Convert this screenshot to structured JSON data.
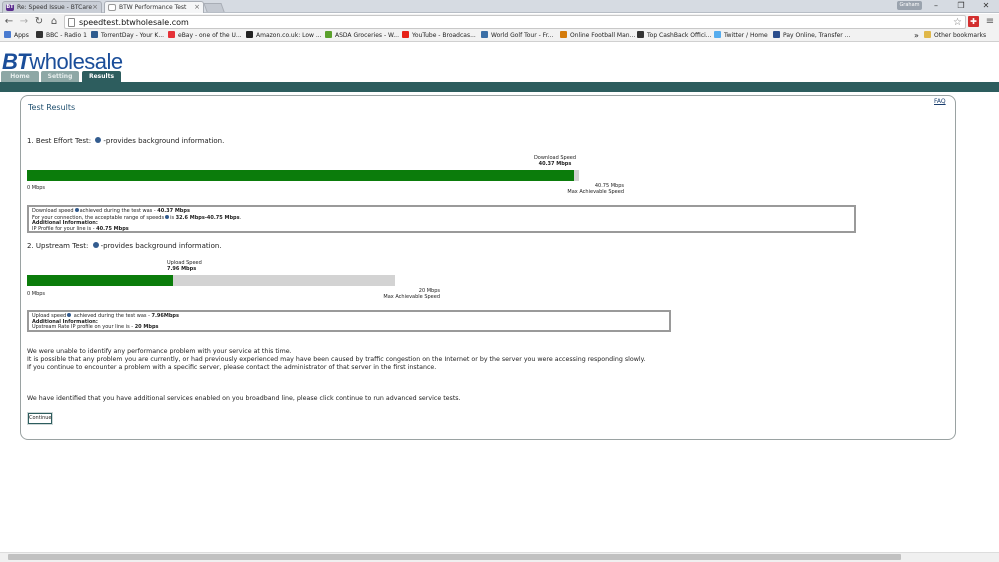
{
  "browser": {
    "tabs": [
      {
        "label": "Re: Speed Issue - BTCare",
        "icon": "BT",
        "active": false
      },
      {
        "label": "BTW Performance Test",
        "icon": "page",
        "active": true
      }
    ],
    "user_badge": "Graham",
    "url": "speedtest.btwholesale.com",
    "bookmarks": [
      {
        "label": "Apps",
        "icon": "grid-icon",
        "color": "#4a7bd0"
      },
      {
        "label": "BBC - Radio 1",
        "icon": "bbc-icon",
        "color": "#333333"
      },
      {
        "label": "TorrentDay - Your K...",
        "icon": "td-icon",
        "color": "#2e5b8e"
      },
      {
        "label": "eBay - one of the U...",
        "icon": "ebay-icon",
        "color": "#e53238"
      },
      {
        "label": "Amazon.co.uk: Low ...",
        "icon": "amazon-icon",
        "color": "#222222"
      },
      {
        "label": "ASDA Groceries - W...",
        "icon": "asda-icon",
        "color": "#5aa02c"
      },
      {
        "label": "YouTube - Broadcas...",
        "icon": "youtube-icon",
        "color": "#e62117"
      },
      {
        "label": "World Golf Tour - Fr...",
        "icon": "globe-icon",
        "color": "#3a6ea5"
      },
      {
        "label": "Online Football Man...",
        "icon": "football-icon",
        "color": "#d47b0b"
      },
      {
        "label": "Top CashBack Offici...",
        "icon": "cashback-icon",
        "color": "#333333"
      },
      {
        "label": "Twitter / Home",
        "icon": "twitter-icon",
        "color": "#55acee"
      },
      {
        "label": "Pay Online, Transfer ...",
        "icon": "paypal-icon",
        "color": "#2b4d8c"
      }
    ],
    "other_bookmarks": "Other bookmarks"
  },
  "site": {
    "logo_bt": "BT",
    "logo_word": "wholesale",
    "nav": [
      "Home",
      "Setting",
      "Results"
    ],
    "active_nav": "Results"
  },
  "results": {
    "title": "Test Results",
    "faq": "FAQ",
    "download": {
      "heading_prefix": "1. Best Effort Test:",
      "heading_suffix": "-provides background information.",
      "label": "Download Speed",
      "speed": "40.37 Mbps",
      "value": 40.37,
      "max": 40.75,
      "min_label": "0 Mbps",
      "max_label": "40.75 Mbps",
      "max_caption": "Max Achievable Speed",
      "info_line1_prefix": "Download speed",
      "info_line1_mid": "achieved during the test was - ",
      "info_line1_value": "40.37 Mbps",
      "info_line2_prefix": "For your connection, the acceptable range of speeds",
      "info_line2_mid": "is ",
      "info_line2_value": "32.6 Mbps-40.75 Mbps",
      "info_line2_end": ".",
      "info_heading": "Additional Information:",
      "info_line3_prefix": "IP Profile for your line is - ",
      "info_line3_value": "40.75 Mbps"
    },
    "upload": {
      "heading_prefix": "2. Upstream Test:",
      "heading_suffix": "-provides background information.",
      "label": "Upload Speed",
      "speed": "7.96 Mbps",
      "value": 7.96,
      "max": 20,
      "min_label": "0 Mbps",
      "max_label": "20 Mbps",
      "max_caption": "Max Achievable Speed",
      "info_line1_prefix": "Upload speed",
      "info_line1_mid": " achieved during the test was - ",
      "info_line1_value": "7.96Mbps",
      "info_heading": "Additional Information:",
      "info_line2_prefix": "Upstream Rate IP profile on your line is - ",
      "info_line2_value": "20 Mbps"
    },
    "message": [
      "We were unable to identify any performance problem with your service at this time.",
      "It is possible that any problem you are currently, or had previously experienced may have been caused by traffic congestion on the Internet or by the server you were accessing responding slowly.",
      "If you continue to encounter a problem with a specific server, please contact the administrator of that server in the first instance."
    ],
    "additional": "We have identified that you have additional services enabled on you broadband line, please click continue to run advanced service tests.",
    "continue_label": "Continue"
  },
  "colors": {
    "brand_blue": "#1a4d99",
    "nav_teal": "#2d5d5e",
    "bar_green": "#0b7c0b",
    "bar_track": "#d3d3d3"
  }
}
